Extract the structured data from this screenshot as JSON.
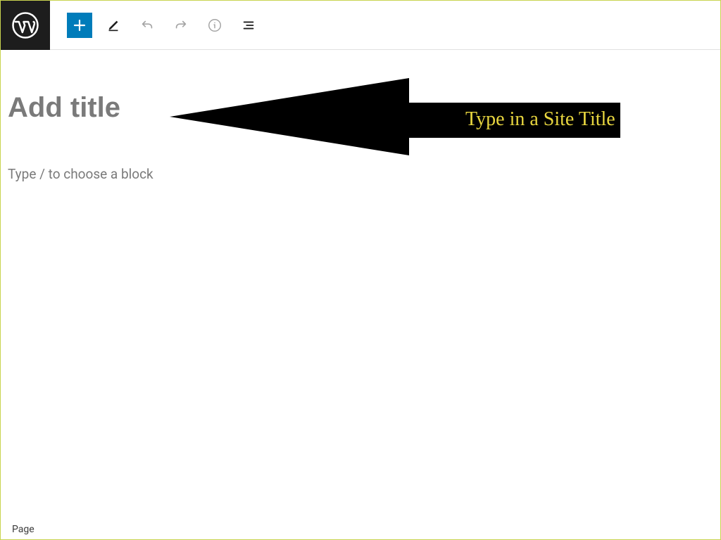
{
  "toolbar": {
    "add_block_aria": "Add block",
    "edit_aria": "Tools",
    "undo_aria": "Undo",
    "redo_aria": "Redo",
    "info_aria": "Details",
    "outline_aria": "Outline"
  },
  "editor": {
    "title_placeholder": "Add title",
    "block_placeholder": "Type / to choose a block"
  },
  "annotation": {
    "text": "Type in a Site Title",
    "text_color": "#e8d63f",
    "bg_color": "#000000"
  },
  "footer": {
    "breadcrumb": "Page"
  }
}
